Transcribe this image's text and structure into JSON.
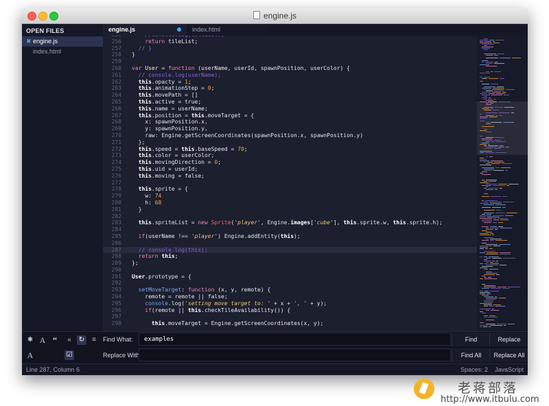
{
  "window": {
    "title": "engine.js"
  },
  "sidebar": {
    "header": "OPEN FILES",
    "items": [
      {
        "label": "engine.js",
        "active": true
      },
      {
        "label": "index.html",
        "active": false
      }
    ]
  },
  "tabs": [
    {
      "label": "engine.js",
      "active": true,
      "dirty": true
    },
    {
      "label": "index.html",
      "active": false,
      "dirty": false
    }
  ],
  "editor": {
    "highlight_line": 287,
    "lines": [
      {
        "n": "255",
        "tokens": [
          [
            "    //console.log(tileList);",
            "cm"
          ]
        ]
      },
      {
        "n": "256",
        "tokens": [
          [
            "    "
          ],
          [
            "return",
            "kw"
          ],
          [
            " tileList;"
          ]
        ]
      },
      {
        "n": "257",
        "tokens": [
          [
            "  "
          ],
          [
            "// }",
            "cm"
          ]
        ]
      },
      {
        "n": "258",
        "tokens": [
          [
            "}"
          ]
        ]
      },
      {
        "n": "259",
        "tokens": [
          [
            ""
          ]
        ]
      },
      {
        "n": "260",
        "tokens": [
          [
            "var",
            "kw"
          ],
          [
            " User = "
          ],
          [
            "function",
            "kw"
          ],
          [
            " (userName, userId, spawnPosition, userColor) {"
          ]
        ]
      },
      {
        "n": "261",
        "tokens": [
          [
            "  "
          ],
          [
            "// console.log(userName);",
            "cm"
          ]
        ]
      },
      {
        "n": "262",
        "tokens": [
          [
            "  "
          ],
          [
            "this",
            "th"
          ],
          [
            ".opacty = "
          ],
          [
            "1",
            "nm"
          ],
          [
            ";"
          ]
        ]
      },
      {
        "n": "263",
        "tokens": [
          [
            "  "
          ],
          [
            "this",
            "th"
          ],
          [
            ".animationStep = "
          ],
          [
            "0",
            "nm"
          ],
          [
            ";"
          ]
        ]
      },
      {
        "n": "264",
        "tokens": [
          [
            "  "
          ],
          [
            "this",
            "th"
          ],
          [
            ".movePath = []"
          ]
        ]
      },
      {
        "n": "265",
        "tokens": [
          [
            "  "
          ],
          [
            "this",
            "th"
          ],
          [
            ".active = true;"
          ]
        ]
      },
      {
        "n": "266",
        "tokens": [
          [
            "  "
          ],
          [
            "this",
            "th"
          ],
          [
            ".name = userName;"
          ]
        ]
      },
      {
        "n": "267",
        "tokens": [
          [
            "  "
          ],
          [
            "this",
            "th"
          ],
          [
            ".position = "
          ],
          [
            "this",
            "th"
          ],
          [
            ".moveTarget = {"
          ]
        ]
      },
      {
        "n": "268",
        "tokens": [
          [
            "    x: spawnPosition.x,"
          ]
        ]
      },
      {
        "n": "269",
        "tokens": [
          [
            "    y: spawnPosition.y,"
          ]
        ]
      },
      {
        "n": "270",
        "tokens": [
          [
            "    raw: Engine.getScreenCoordinates(spawnPosition.x, spawnPosition.y)"
          ]
        ]
      },
      {
        "n": "271",
        "tokens": [
          [
            "  };"
          ]
        ]
      },
      {
        "n": "272",
        "tokens": [
          [
            "  "
          ],
          [
            "this",
            "th"
          ],
          [
            ".speed = "
          ],
          [
            "this",
            "th"
          ],
          [
            ".baseSpeed = "
          ],
          [
            "70",
            "nm"
          ],
          [
            ";"
          ]
        ]
      },
      {
        "n": "273",
        "tokens": [
          [
            "  "
          ],
          [
            "this",
            "th"
          ],
          [
            ".color = userColor;"
          ]
        ]
      },
      {
        "n": "274",
        "tokens": [
          [
            "  "
          ],
          [
            "this",
            "th"
          ],
          [
            ".movingDirection = "
          ],
          [
            "0",
            "nm"
          ],
          [
            ";"
          ]
        ]
      },
      {
        "n": "275",
        "tokens": [
          [
            "  "
          ],
          [
            "this",
            "th"
          ],
          [
            ".uid = userId;"
          ]
        ]
      },
      {
        "n": "276",
        "tokens": [
          [
            "  "
          ],
          [
            "this",
            "th"
          ],
          [
            ".moving = false;"
          ]
        ]
      },
      {
        "n": "277",
        "tokens": [
          [
            ""
          ]
        ]
      },
      {
        "n": "278",
        "tokens": [
          [
            "  "
          ],
          [
            "this",
            "th"
          ],
          [
            ".sprite = {"
          ]
        ]
      },
      {
        "n": "279",
        "tokens": [
          [
            "    w: "
          ],
          [
            "74",
            "nm"
          ]
        ]
      },
      {
        "n": "280",
        "tokens": [
          [
            "    h: "
          ],
          [
            "68",
            "nm"
          ]
        ]
      },
      {
        "n": "281",
        "tokens": [
          [
            "  }"
          ]
        ]
      },
      {
        "n": "282",
        "tokens": [
          [
            ""
          ]
        ]
      },
      {
        "n": "283",
        "tokens": [
          [
            "  "
          ],
          [
            "this",
            "th"
          ],
          [
            ".spriteList = "
          ],
          [
            "new",
            "kw"
          ],
          [
            " "
          ],
          [
            "Sprite",
            "cl"
          ],
          [
            "("
          ],
          [
            "'player'",
            "st"
          ],
          [
            ", Engine."
          ],
          [
            "images",
            "th"
          ],
          [
            "["
          ],
          [
            "'cube'",
            "st"
          ],
          [
            "], "
          ],
          [
            "this",
            "th"
          ],
          [
            ".sprite.w, "
          ],
          [
            "this",
            "th"
          ],
          [
            ".sprite.h);"
          ]
        ]
      },
      {
        "n": "284",
        "tokens": [
          [
            ""
          ]
        ]
      },
      {
        "n": "285",
        "tokens": [
          [
            "  "
          ],
          [
            "if",
            "kw"
          ],
          [
            "(userName !== "
          ],
          [
            "'player'",
            "st"
          ],
          [
            ") Engine.addEntity("
          ],
          [
            "this",
            "th"
          ],
          [
            ");"
          ]
        ]
      },
      {
        "n": "286",
        "tokens": [
          [
            ""
          ]
        ]
      },
      {
        "n": "287",
        "tokens": [
          [
            "  "
          ],
          [
            "// console.log(this);",
            "cm"
          ]
        ]
      },
      {
        "n": "288",
        "tokens": [
          [
            "  "
          ],
          [
            "return",
            "kw"
          ],
          [
            " "
          ],
          [
            "this",
            "th"
          ],
          [
            ";"
          ]
        ]
      },
      {
        "n": "289",
        "tokens": [
          [
            "};"
          ]
        ]
      },
      {
        "n": "290",
        "tokens": [
          [
            ""
          ]
        ]
      },
      {
        "n": "291",
        "tokens": [
          [
            "User",
            "th"
          ],
          [
            ".prototype = {"
          ]
        ]
      },
      {
        "n": "292",
        "tokens": [
          [
            ""
          ]
        ]
      },
      {
        "n": "293",
        "tokens": [
          [
            "  "
          ],
          [
            "setMoveTarget",
            "fn"
          ],
          [
            ": "
          ],
          [
            "function",
            "kw"
          ],
          [
            " (x, y, remote) {"
          ]
        ]
      },
      {
        "n": "294",
        "tokens": [
          [
            "    remote = remote || false;"
          ]
        ]
      },
      {
        "n": "295",
        "tokens": [
          [
            "    "
          ],
          [
            "console",
            "fn"
          ],
          [
            ".log("
          ],
          [
            "'setting move target to: '",
            "st"
          ],
          [
            " + x + "
          ],
          [
            "', '",
            "st"
          ],
          [
            " + y);"
          ]
        ]
      },
      {
        "n": "296",
        "tokens": [
          [
            "    "
          ],
          [
            "if",
            "kw"
          ],
          [
            "(remote || "
          ],
          [
            "this",
            "th"
          ],
          [
            ".checkTileAvailability()) {"
          ]
        ]
      },
      {
        "n": "297",
        "tokens": [
          [
            ""
          ]
        ]
      },
      {
        "n": "298",
        "tokens": [
          [
            "      "
          ],
          [
            "this",
            "th"
          ],
          [
            ".moveTarget = Engine.getScreenCoordinates(x, y);"
          ]
        ]
      }
    ]
  },
  "findbar": {
    "find_label": "Find What:",
    "find_value": "examples",
    "replace_label": "Replace With:",
    "replace_value": "",
    "find_button": "Find",
    "replace_button": "Replace",
    "find_all_button": "Find All",
    "replace_all_button": "Replace All",
    "icons": [
      "regex-icon",
      "case-sensitive-icon",
      "whole-word-icon",
      "reverse-icon",
      "wrap-icon",
      "in-selection-icon",
      "highlight-matches-icon",
      "preserve-case-icon"
    ]
  },
  "status": {
    "position": "Line 287, Column 6",
    "indent": "Spaces: 2",
    "syntax": "JavaScript"
  },
  "watermark": {
    "name": "老蒋部落",
    "url": "http://www.itbulu.com"
  },
  "colors": {
    "background": "#1b1f2e",
    "keyword": "#ec84b8",
    "comment": "#8b63d8",
    "number": "#f8a33b",
    "string": "#f0c674",
    "function": "#7ea6f2"
  }
}
